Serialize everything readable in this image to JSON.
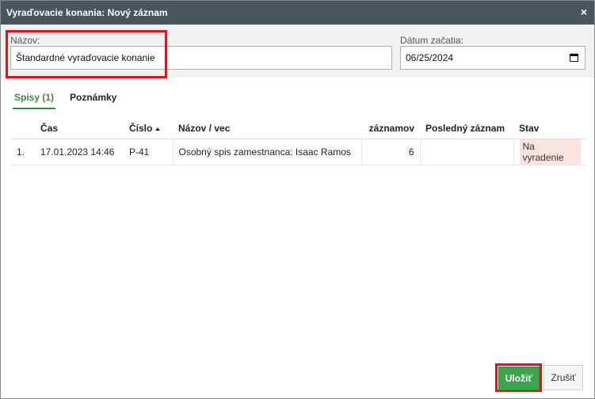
{
  "dialog": {
    "title": "Vyraďovacie konania: Nový záznam",
    "close_label": "×"
  },
  "form": {
    "name_label": "Názov:",
    "name_value": "Štandardné vyraďovacie konanie",
    "date_label": "Dátum začatia:",
    "date_value": "06/25/2024"
  },
  "tabs": [
    {
      "label": "Spisy (1)",
      "active": true
    },
    {
      "label": "Poznámky",
      "active": false
    }
  ],
  "table": {
    "headers": [
      "",
      "Čas",
      "Číslo",
      "Názov / vec",
      "záznamov",
      "Posledný záznam",
      "Stav"
    ],
    "sorted_column": "Číslo",
    "rows": [
      {
        "index": "1.",
        "time": "17.01.2023 14:46",
        "number": "P-41",
        "name": "Osobný spis zamestnanca: Isaac Ramos",
        "records": "6",
        "last_record": "",
        "status": "Na vyradenie"
      }
    ]
  },
  "buttons": {
    "save": "Uložiť",
    "cancel": "Zrušiť"
  },
  "colors": {
    "titlebar": "#4a565d",
    "accent_green": "#3e8a3e",
    "highlight_red": "#e1121b",
    "save_green": "#3aa64a",
    "status_badge": "#fbe4e0"
  }
}
